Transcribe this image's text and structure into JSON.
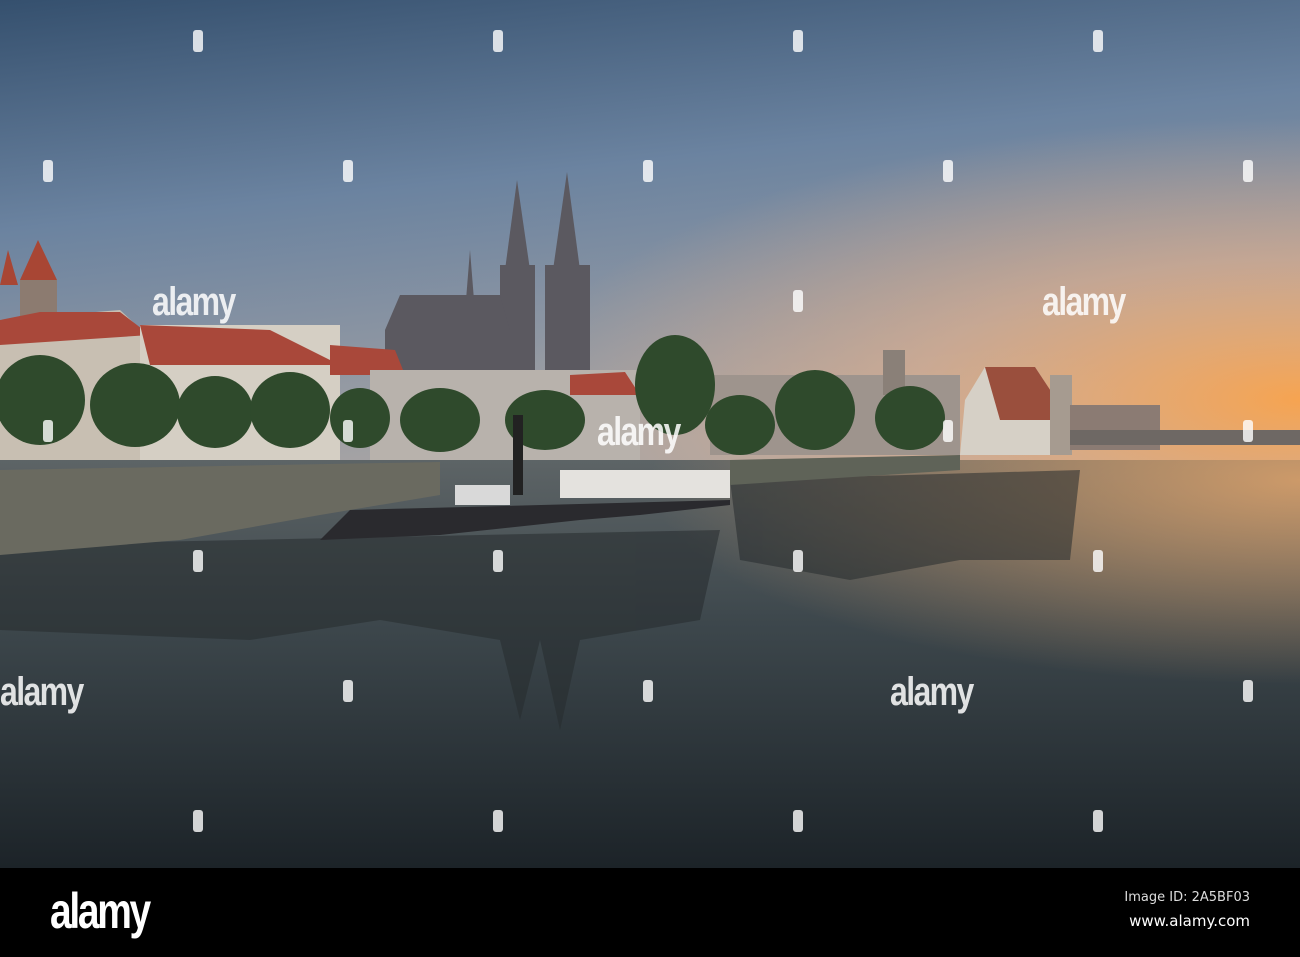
{
  "photo": {
    "subject": "Regensburg riverfront",
    "colors": {
      "sky_top": "#3b5a7a",
      "sky_horizon": "#f3a95e",
      "water_top": "#6b6f70",
      "water_bottom": "#1d2428",
      "roofs": "#a9483a"
    }
  },
  "watermark": {
    "text": "alamy"
  },
  "footer": {
    "logo": "alamy",
    "image_id": "Image ID: 2A5BF03",
    "website": "www.alamy.com"
  }
}
